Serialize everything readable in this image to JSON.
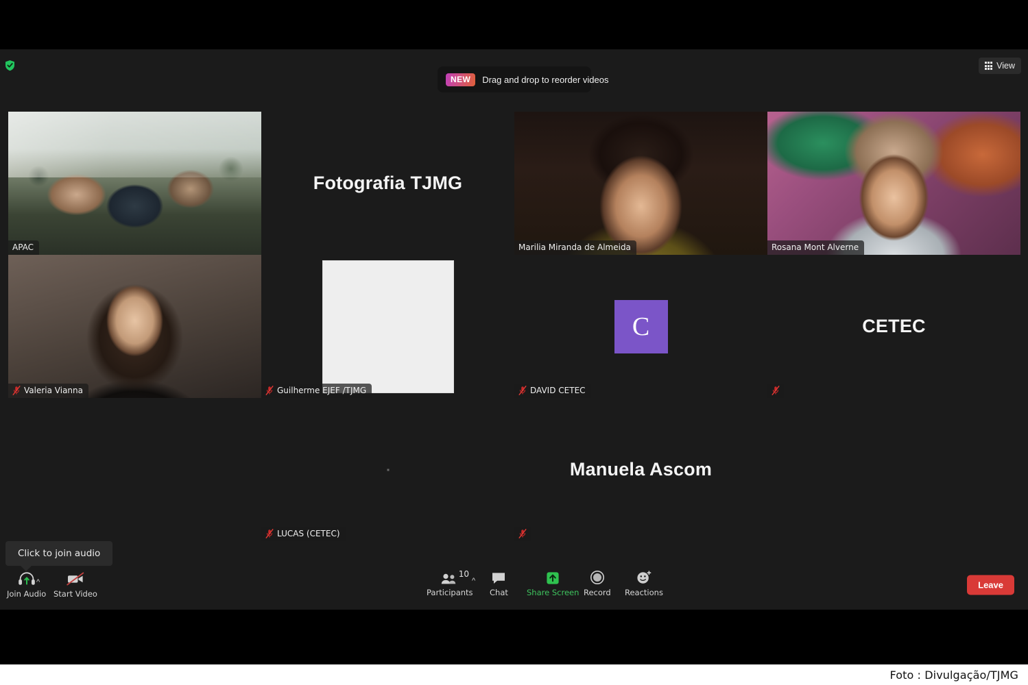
{
  "window": {
    "background_color": "#1b1b1b",
    "encryption_icon": "shield-check-icon",
    "view_button_label": "View",
    "view_button_icon": "grid-icon"
  },
  "banner": {
    "badge": "NEW",
    "message": "Drag and drop to reorder videos"
  },
  "gallery": {
    "tiles": [
      {
        "id": "apac",
        "name": "APAC",
        "kind": "video",
        "active_speaker": true,
        "muted": false,
        "show_plate": true
      },
      {
        "id": "fotografia-tjmg",
        "name": "Fotografia TJMG",
        "kind": "name-only",
        "active_speaker": false,
        "muted": false,
        "show_plate": false
      },
      {
        "id": "marilia-miranda-de-almeida",
        "name": "Marilia Miranda de Almeida",
        "kind": "video",
        "active_speaker": false,
        "muted": false,
        "show_plate": true
      },
      {
        "id": "rosana-mont-alverne",
        "name": "Rosana Mont Alverne",
        "kind": "video",
        "active_speaker": false,
        "muted": false,
        "show_plate": true
      },
      {
        "id": "valeria-vianna",
        "name": "Valeria Vianna",
        "kind": "video",
        "active_speaker": false,
        "muted": true,
        "show_plate": true
      },
      {
        "id": "guilherme-ejef-tjmg",
        "name": "Guilherme EJEF /TJMG",
        "kind": "white-document",
        "active_speaker": false,
        "muted": true,
        "show_plate": true
      },
      {
        "id": "david-cetec",
        "name": "DAVID CETEC",
        "kind": "avatar-letter",
        "avatar_letter": "C",
        "avatar_color": "#7b55c8",
        "active_speaker": false,
        "muted": true,
        "show_plate": true
      },
      {
        "id": "cetec",
        "name": "CETEC",
        "kind": "name-only",
        "active_speaker": false,
        "muted": true,
        "show_plate": true,
        "plate_name": ""
      },
      {
        "id": "empty-1",
        "name": "",
        "kind": "empty",
        "active_speaker": false,
        "muted": false,
        "show_plate": false
      },
      {
        "id": "lucas-cetec",
        "name": "LUCAS (CETEC)",
        "kind": "dot",
        "active_speaker": false,
        "muted": true,
        "show_plate": true
      },
      {
        "id": "manuela-ascom",
        "name": "Manuela Ascom",
        "kind": "name-only",
        "active_speaker": false,
        "muted": true,
        "show_plate": true,
        "plate_name": ""
      },
      {
        "id": "empty-2",
        "name": "",
        "kind": "empty",
        "active_speaker": false,
        "muted": false,
        "show_plate": false
      }
    ]
  },
  "toolbar": {
    "join_audio_tooltip": "Click to join audio",
    "join_audio_label": "Join Audio",
    "start_video_label": "Start Video",
    "participants_label": "Participants",
    "participants_count": "10",
    "chat_label": "Chat",
    "share_screen_label": "Share Screen",
    "share_screen_color": "#3ec45e",
    "record_label": "Record",
    "reactions_label": "Reactions",
    "leave_label": "Leave",
    "leave_color": "#d93a37"
  },
  "footer": {
    "credit": "Foto : Divulgação/TJMG"
  }
}
